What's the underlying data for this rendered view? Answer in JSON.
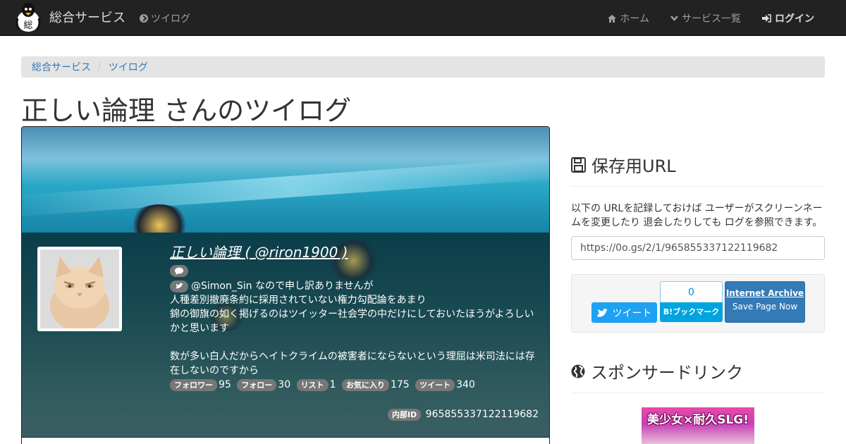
{
  "navbar": {
    "brand": "総合サービス",
    "twilog_link": "ツイログ",
    "home": "ホーム",
    "services": "サービス一覧",
    "login": "ログイン"
  },
  "breadcrumb": [
    "総合サービス",
    "ツイログ"
  ],
  "page_title": "正しい論理 さんのツイログ",
  "profile": {
    "name": "正しい論理 ( @riron1900 )",
    "bio_line1": "@Simon_Sin なので申し訳ありませんが",
    "bio_line2": "人種差別撤廃条約に採用されていない権力勾配論をあまり",
    "bio_line3": "錦の御旗の如く掲げるのはツイッター社会学の中だけにしておいたほうがよろしいかと思います",
    "bio_line4": "数が多い白人だからヘイトクライムの被害者にならないという理屈は米司法には存在しないのですから",
    "stats": [
      {
        "label": "フォロワー",
        "value": "95"
      },
      {
        "label": "フォロー",
        "value": "30"
      },
      {
        "label": "リスト",
        "value": "1"
      },
      {
        "label": "お気に入り",
        "value": "175"
      },
      {
        "label": "ツイート",
        "value": "340"
      }
    ],
    "internal_id_label": "内部ID",
    "internal_id": "965855337122119682"
  },
  "save_url": {
    "title": "保存用URL",
    "description": "以下の URLを記録しておけば ユーザーがスクリーンネームを変更したり 退会したりしても ログを参照できます。",
    "url": "https://0o.gs/2/1/965855337122119682"
  },
  "share": {
    "tweet": "ツイート",
    "hatena_count": "0",
    "hatena_label": "B!ブックマーク",
    "archive_title": "Internet Archive",
    "archive_sub": "Save Page Now"
  },
  "sponsored": {
    "title": "スポンサードリンク",
    "ad_text": "美少女×耐久SLG!"
  },
  "colors": {
    "navbar_bg": "#222222",
    "link": "#337ab7",
    "twitter": "#1da1f2",
    "hatena": "#00a4de"
  }
}
